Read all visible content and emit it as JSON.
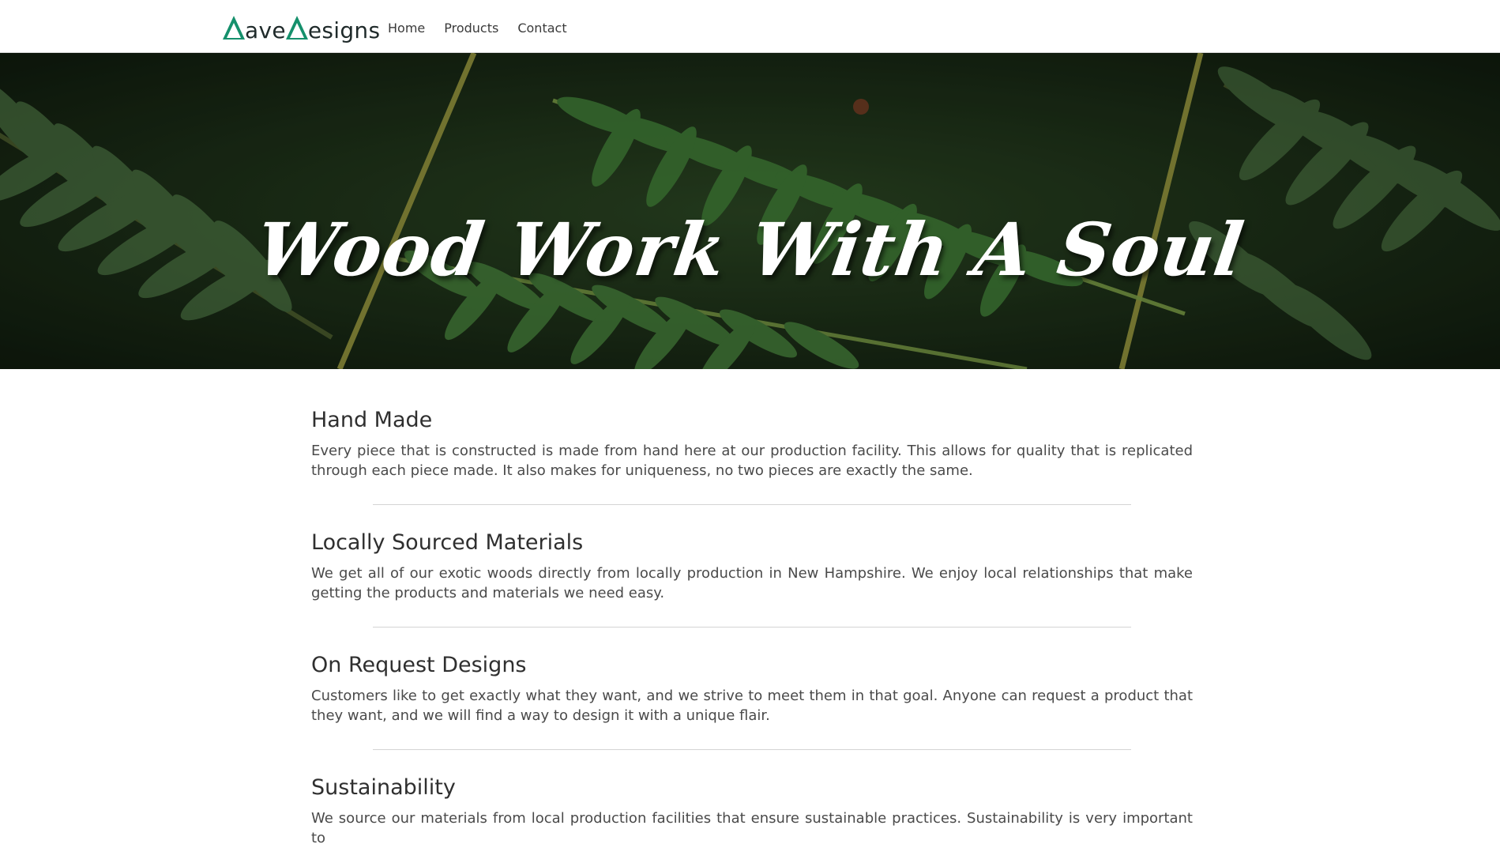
{
  "brand": {
    "letter1": "ave",
    "letter2": "esigns"
  },
  "nav": {
    "items": [
      "Home",
      "Products",
      "Contact"
    ]
  },
  "hero": {
    "title": "Wood Work With A Soul"
  },
  "sections": [
    {
      "title": "Hand Made",
      "body": "Every piece that is constructed is made from hand here at our production facility. This allows for quality that is replicated through each piece made. It also makes for uniqueness, no two pieces are exactly the same."
    },
    {
      "title": "Locally Sourced Materials",
      "body": "We get all of our exotic woods directly from locally production in New Hampshire. We enjoy local relationships that make getting the products and materials we need easy."
    },
    {
      "title": "On Request Designs",
      "body": "Customers like to get exactly what they want, and we strive to meet them in that goal. Anyone can request a product that they want, and we will find a way to design it with a unique flair."
    },
    {
      "title": "Sustainability",
      "body": "We source our materials from local production facilities that ensure sustainable practices. Sustainability is very important to"
    }
  ],
  "colors": {
    "brand_accent": "#15906c",
    "hero_dark": "#1b2b16",
    "fern_green": "#3f7a36"
  }
}
